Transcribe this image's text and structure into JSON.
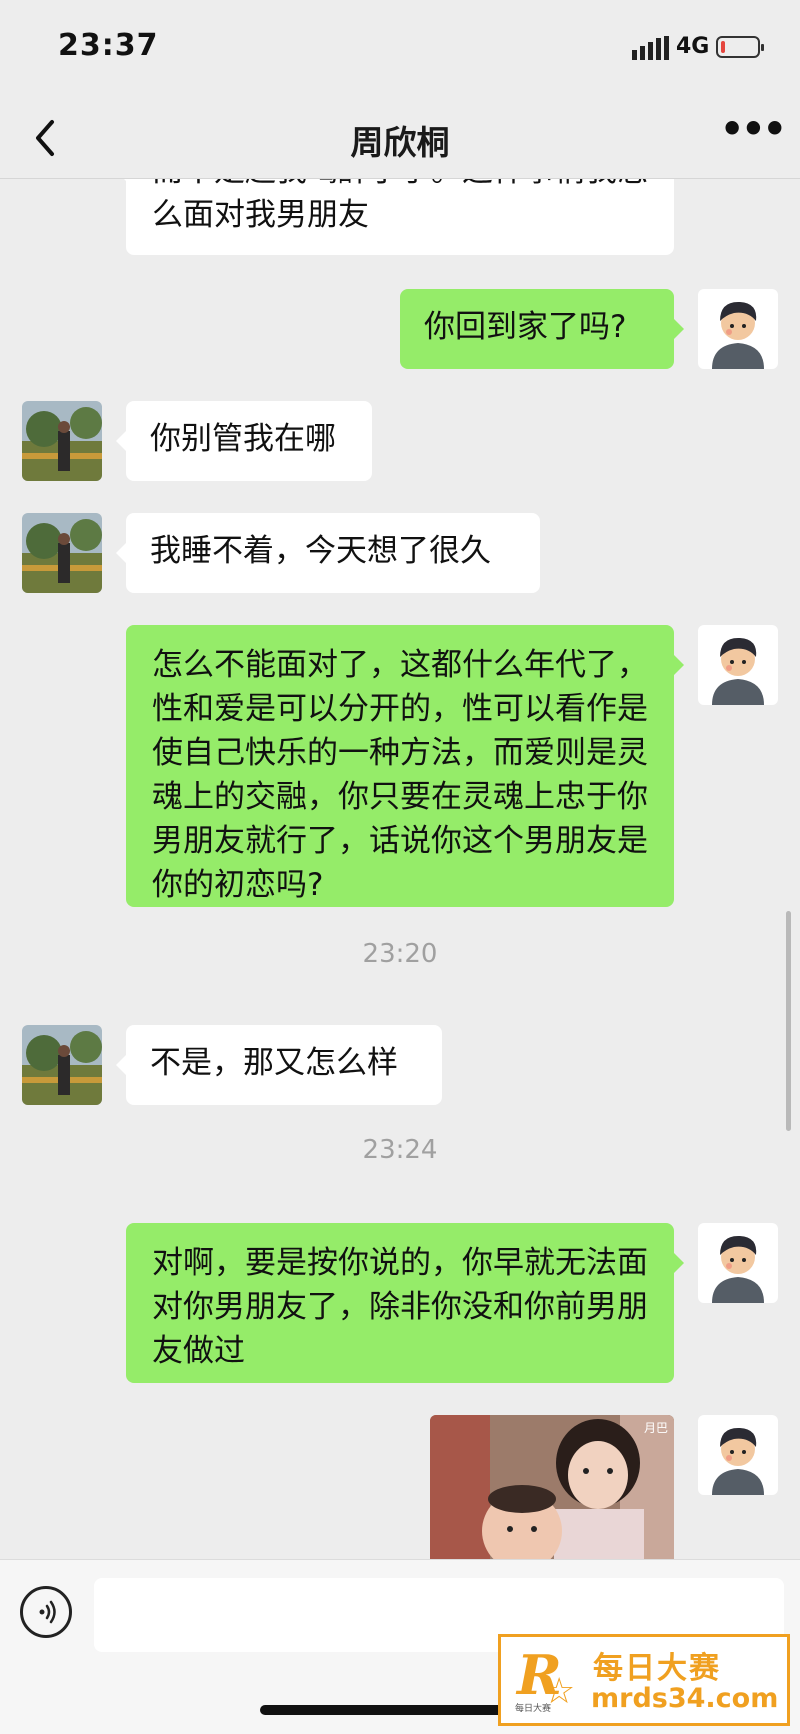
{
  "status_bar": {
    "time": "23:37",
    "network": "4G",
    "battery_level": 0.12
  },
  "header": {
    "title": "周欣桐",
    "more_label": "•••"
  },
  "messages": [
    {
      "side": "in",
      "text": "而不是趁我喝醉了手。这样事情我怎么面对我男朋友"
    },
    {
      "side": "out",
      "text": "你回到家了吗?"
    },
    {
      "side": "in",
      "text": "你别管我在哪"
    },
    {
      "side": "in",
      "text": "我睡不着，今天想了很久"
    },
    {
      "side": "out",
      "text": "怎么不能面对了，这都什么年代了，性和爱是可以分开的，性可以看作是使自己快乐的一种方法，而爱则是灵魂上的交融，你只要在灵魂上忠于你男朋友就行了，话说你这个男朋友是你的初恋吗?"
    },
    {
      "side": "in",
      "text": "不是，那又怎么样"
    },
    {
      "side": "out",
      "text": "对啊，要是按你说的，你早就无法面对你男朋友了，除非你没和你前男朋友做过"
    }
  ],
  "timestamps": [
    "23:20",
    "23:24"
  ],
  "photo_caption": "月巴",
  "watermark": {
    "letter": "R",
    "small": "每日大赛",
    "title": "每日大赛",
    "url": "mrds34.com"
  },
  "colors": {
    "outgoing_bubble": "#95ec69",
    "incoming_bubble": "#ffffff",
    "background": "#ededed"
  }
}
